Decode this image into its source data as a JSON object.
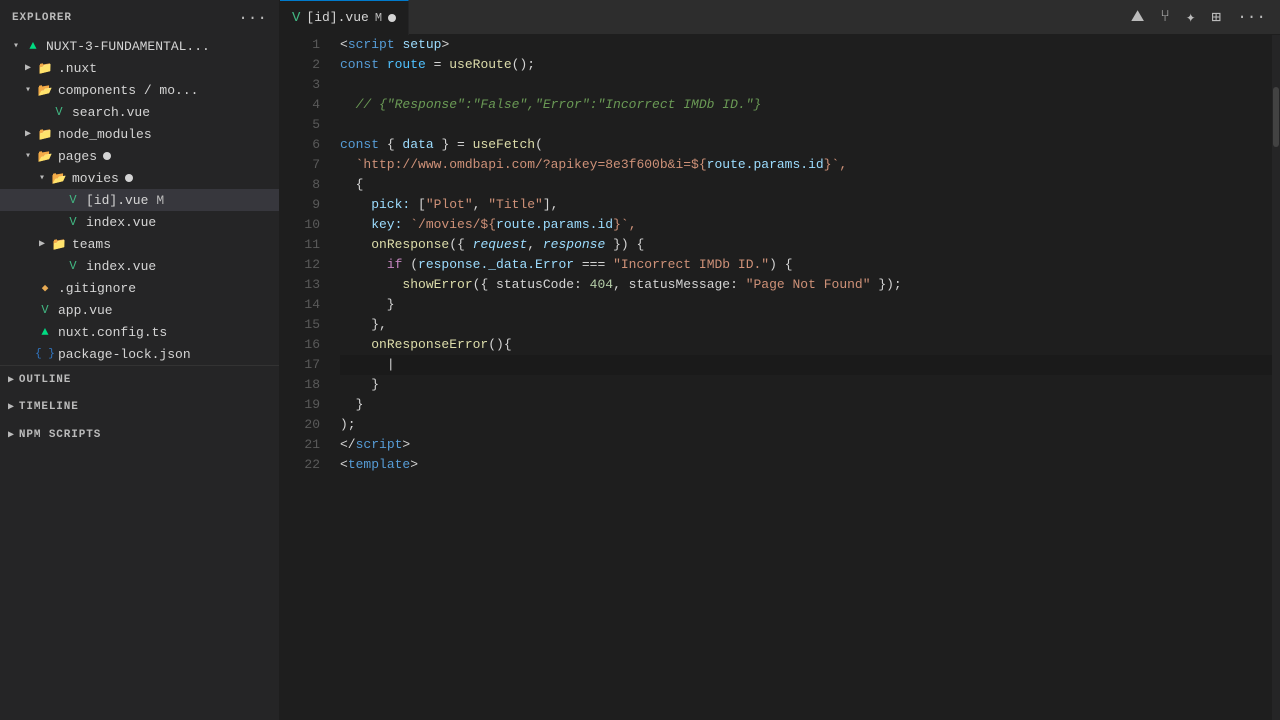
{
  "sidebar": {
    "title": "EXPLORER",
    "dots_label": "···",
    "root": {
      "name": "NUXT-3-FUNDAMENTAL...",
      "expanded": true
    },
    "tree": [
      {
        "id": "nuxt",
        "label": ".nuxt",
        "indent": 1,
        "type": "folder-closed",
        "expanded": false
      },
      {
        "id": "components-mo",
        "label": "components / mo...",
        "indent": 1,
        "type": "folder-open",
        "expanded": true
      },
      {
        "id": "search-vue",
        "label": "search.vue",
        "indent": 2,
        "type": "vue"
      },
      {
        "id": "node-modules",
        "label": "node_modules",
        "indent": 1,
        "type": "folder-special",
        "expanded": false
      },
      {
        "id": "pages",
        "label": "pages",
        "indent": 1,
        "type": "folder-open-modified",
        "expanded": true,
        "modified": true
      },
      {
        "id": "movies",
        "label": "movies",
        "indent": 2,
        "type": "folder-open-modified",
        "expanded": true,
        "modified": true
      },
      {
        "id": "id-vue",
        "label": "[id].vue",
        "indent": 3,
        "type": "vue",
        "modified": true,
        "selected": true
      },
      {
        "id": "index-vue-movies",
        "label": "index.vue",
        "indent": 3,
        "type": "vue"
      },
      {
        "id": "teams",
        "label": "teams",
        "indent": 2,
        "type": "folder-closed",
        "expanded": false
      },
      {
        "id": "index-vue",
        "label": "index.vue",
        "indent": 3,
        "type": "vue"
      },
      {
        "id": "gitignore",
        "label": ".gitignore",
        "indent": 1,
        "type": "git"
      },
      {
        "id": "app-vue",
        "label": "app.vue",
        "indent": 1,
        "type": "vue"
      },
      {
        "id": "nuxt-config",
        "label": "nuxt.config.ts",
        "indent": 1,
        "type": "nuxt"
      },
      {
        "id": "package-lock",
        "label": "package-lock.json",
        "indent": 1,
        "type": "json"
      }
    ],
    "bottom_sections": [
      {
        "id": "outline",
        "label": "OUTLINE",
        "expanded": false
      },
      {
        "id": "timeline",
        "label": "TIMELINE",
        "expanded": false
      },
      {
        "id": "npm-scripts",
        "label": "NPM SCRIPTS",
        "expanded": false
      }
    ]
  },
  "tab": {
    "icon": "V",
    "label": "[id].vue",
    "modifier": "M",
    "modified_dot": true
  },
  "top_icons": [
    "mountain-icon",
    "branch-icon",
    "extension-icon",
    "layout-icon",
    "more-icon"
  ],
  "code": {
    "lines": [
      {
        "num": 1,
        "tokens": [
          {
            "t": "<",
            "c": "punct"
          },
          {
            "t": "script",
            "c": "tag2"
          },
          {
            "t": " ",
            "c": ""
          },
          {
            "t": "setup",
            "c": "attr"
          },
          {
            "t": ">",
            "c": "punct"
          }
        ]
      },
      {
        "num": 2,
        "tokens": [
          {
            "t": "const ",
            "c": "kw"
          },
          {
            "t": "route",
            "c": "const-name"
          },
          {
            "t": " = ",
            "c": "punct"
          },
          {
            "t": "useRoute",
            "c": "fn"
          },
          {
            "t": "();",
            "c": "punct"
          }
        ]
      },
      {
        "num": 3,
        "tokens": []
      },
      {
        "num": 4,
        "tokens": [
          {
            "t": "  // {\"Response\":\"False\",\"Error\":\"Incorrect IMDb ID.\"}",
            "c": "comment"
          }
        ]
      },
      {
        "num": 5,
        "tokens": []
      },
      {
        "num": 6,
        "tokens": [
          {
            "t": "const ",
            "c": "kw"
          },
          {
            "t": "{ ",
            "c": "punct"
          },
          {
            "t": "data",
            "c": "var"
          },
          {
            "t": " } = ",
            "c": "punct"
          },
          {
            "t": "useFetch",
            "c": "fn"
          },
          {
            "t": "(",
            "c": "punct"
          }
        ]
      },
      {
        "num": 7,
        "tokens": [
          {
            "t": "  `http://www.omdbapi.com/?apikey=8e3f600b&i=${",
            "c": "str"
          },
          {
            "t": "route.params.id",
            "c": "var"
          },
          {
            "t": "}",
            "c": "str"
          },
          {
            "t": "`,",
            "c": "str"
          }
        ]
      },
      {
        "num": 8,
        "tokens": [
          {
            "t": "  {",
            "c": "punct"
          }
        ]
      },
      {
        "num": 9,
        "tokens": [
          {
            "t": "    pick: ",
            "c": "prop"
          },
          {
            "t": "[",
            "c": "punct"
          },
          {
            "t": "\"Plot\"",
            "c": "str"
          },
          {
            "t": ", ",
            "c": "punct"
          },
          {
            "t": "\"Title\"",
            "c": "str"
          },
          {
            "t": "],",
            "c": "punct"
          }
        ]
      },
      {
        "num": 10,
        "tokens": [
          {
            "t": "    key: ",
            "c": "prop"
          },
          {
            "t": "`/movies/${",
            "c": "str"
          },
          {
            "t": "route.params.id",
            "c": "var"
          },
          {
            "t": "}",
            "c": "str"
          },
          {
            "t": "`,",
            "c": "str"
          }
        ]
      },
      {
        "num": 11,
        "tokens": [
          {
            "t": "    ",
            "c": ""
          },
          {
            "t": "onResponse",
            "c": "fn"
          },
          {
            "t": "({ ",
            "c": "punct"
          },
          {
            "t": "request",
            "c": "param"
          },
          {
            "t": ", ",
            "c": "punct"
          },
          {
            "t": "response",
            "c": "param"
          },
          {
            "t": " }) {",
            "c": "punct"
          }
        ]
      },
      {
        "num": 12,
        "tokens": [
          {
            "t": "      ",
            "c": ""
          },
          {
            "t": "if",
            "c": "kw2"
          },
          {
            "t": " (",
            "c": "punct"
          },
          {
            "t": "response._data.Error",
            "c": "var"
          },
          {
            "t": " === ",
            "c": "punct"
          },
          {
            "t": "\"Incorrect IMDb ID.\"",
            "c": "str"
          },
          {
            "t": ") {",
            "c": "punct"
          }
        ]
      },
      {
        "num": 13,
        "tokens": [
          {
            "t": "        ",
            "c": ""
          },
          {
            "t": "showError",
            "c": "fn"
          },
          {
            "t": "({ statusCode: ",
            "c": "punct"
          },
          {
            "t": "404",
            "c": "num"
          },
          {
            "t": ", statusMessage: ",
            "c": "punct"
          },
          {
            "t": "\"Page Not Found\"",
            "c": "str"
          },
          {
            "t": " });",
            "c": "punct"
          }
        ]
      },
      {
        "num": 14,
        "tokens": [
          {
            "t": "      }",
            "c": "punct"
          }
        ]
      },
      {
        "num": 15,
        "tokens": [
          {
            "t": "    },",
            "c": "punct"
          }
        ]
      },
      {
        "num": 16,
        "tokens": [
          {
            "t": "    ",
            "c": ""
          },
          {
            "t": "onResponseError",
            "c": "fn"
          },
          {
            "t": "(){",
            "c": "punct"
          }
        ]
      },
      {
        "num": 17,
        "tokens": [
          {
            "t": "      ",
            "c": ""
          },
          {
            "t": "|",
            "c": "punct"
          }
        ],
        "cursor": true
      },
      {
        "num": 18,
        "tokens": [
          {
            "t": "    }",
            "c": "punct"
          }
        ]
      },
      {
        "num": 19,
        "tokens": [
          {
            "t": "  }",
            "c": "punct"
          }
        ]
      },
      {
        "num": 20,
        "tokens": [
          {
            "t": ");",
            "c": "punct"
          }
        ]
      },
      {
        "num": 21,
        "tokens": [
          {
            "t": "</",
            "c": "punct"
          },
          {
            "t": "script",
            "c": "tag2"
          },
          {
            "t": ">",
            "c": "punct"
          }
        ]
      },
      {
        "num": 22,
        "tokens": [
          {
            "t": "<",
            "c": "punct"
          },
          {
            "t": "template",
            "c": "tag2"
          },
          {
            "t": ">",
            "c": "punct"
          }
        ]
      }
    ]
  }
}
